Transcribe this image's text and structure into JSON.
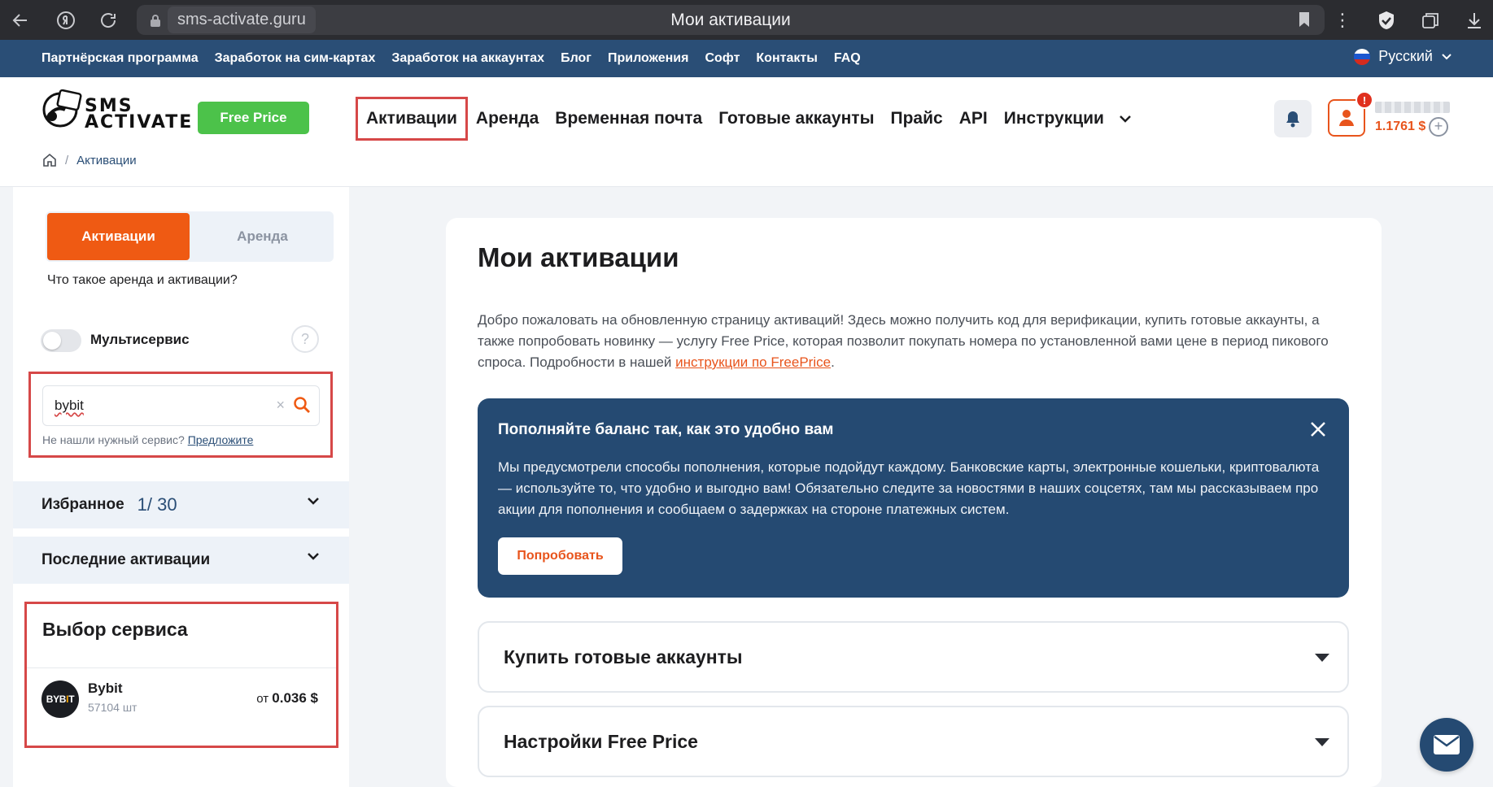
{
  "browser": {
    "url": "sms-activate.guru",
    "tab_title": "Мои активации"
  },
  "topbar": {
    "links": [
      "Партнёрская программа",
      "Заработок на сим-картах",
      "Заработок на аккаунтах",
      "Блог",
      "Приложения",
      "Софт",
      "Контакты",
      "FAQ"
    ],
    "language": "Русский"
  },
  "header": {
    "logo_text": "SMS ACTIVATE",
    "free_price_label": "Free Price",
    "nav": [
      "Активации",
      "Аренда",
      "Временная почта",
      "Готовые аккаунты",
      "Прайс",
      "API",
      "Инструкции"
    ],
    "notification_badge": "!",
    "balance": "1.1761 $",
    "add_balance": "+"
  },
  "breadcrumb": {
    "current": "Активации"
  },
  "sidebar": {
    "segment_active": "Активации",
    "segment_other": "Аренда",
    "what_is_link": "Что такое аренда и активации?",
    "multiservice_label": "Мультисервис",
    "help": "?",
    "search": {
      "value": "bybit",
      "clear": "×",
      "not_found_text": "Не нашли нужный сервис?",
      "suggest_link": "Предложите"
    },
    "favorites": {
      "label": "Избранное",
      "count": "1/ 30"
    },
    "recent_label": "Последние активации",
    "service_select": {
      "heading": "Выбор сервиса",
      "service": {
        "name": "Bybit",
        "count": "57104 шт",
        "price_prefix": "от",
        "price": "0.036 $",
        "logo_text": "BYB",
        "logo_accent": "I",
        "logo_end": "T"
      }
    }
  },
  "main": {
    "title": "Мои активации",
    "intro_text": "Добро пожаловать на обновленную страницу активаций! Здесь можно получить код для верификации, купить готовые аккаунты, а также попробовать новинку — услугу Free Price, которая позволит покупать номера по установленной вами цене в период пикового спроса. Подробности в нашей",
    "intro_link": "инструкции по FreePrice",
    "intro_end": ".",
    "promo": {
      "title": "Пополняйте баланс так, как это удобно вам",
      "description": "Мы предусмотрели способы пополнения, которые подойдут каждому. Банковские карты, электронные кошельки, криптовалюта — используйте то, что удобно и выгодно вам! Обязательно следите за новостями в наших соцсетях, там мы рассказываем про акции для пополнения и сообщаем о задержках на стороне платежных систем.",
      "button": "Попробовать"
    },
    "accordions": [
      "Купить готовые аккаунты",
      "Настройки Free Price"
    ]
  },
  "colors": {
    "accent_orange": "#ef5a13",
    "brand_blue": "#2a4e76",
    "green": "#4cc24a",
    "highlight_red": "#d64848"
  }
}
